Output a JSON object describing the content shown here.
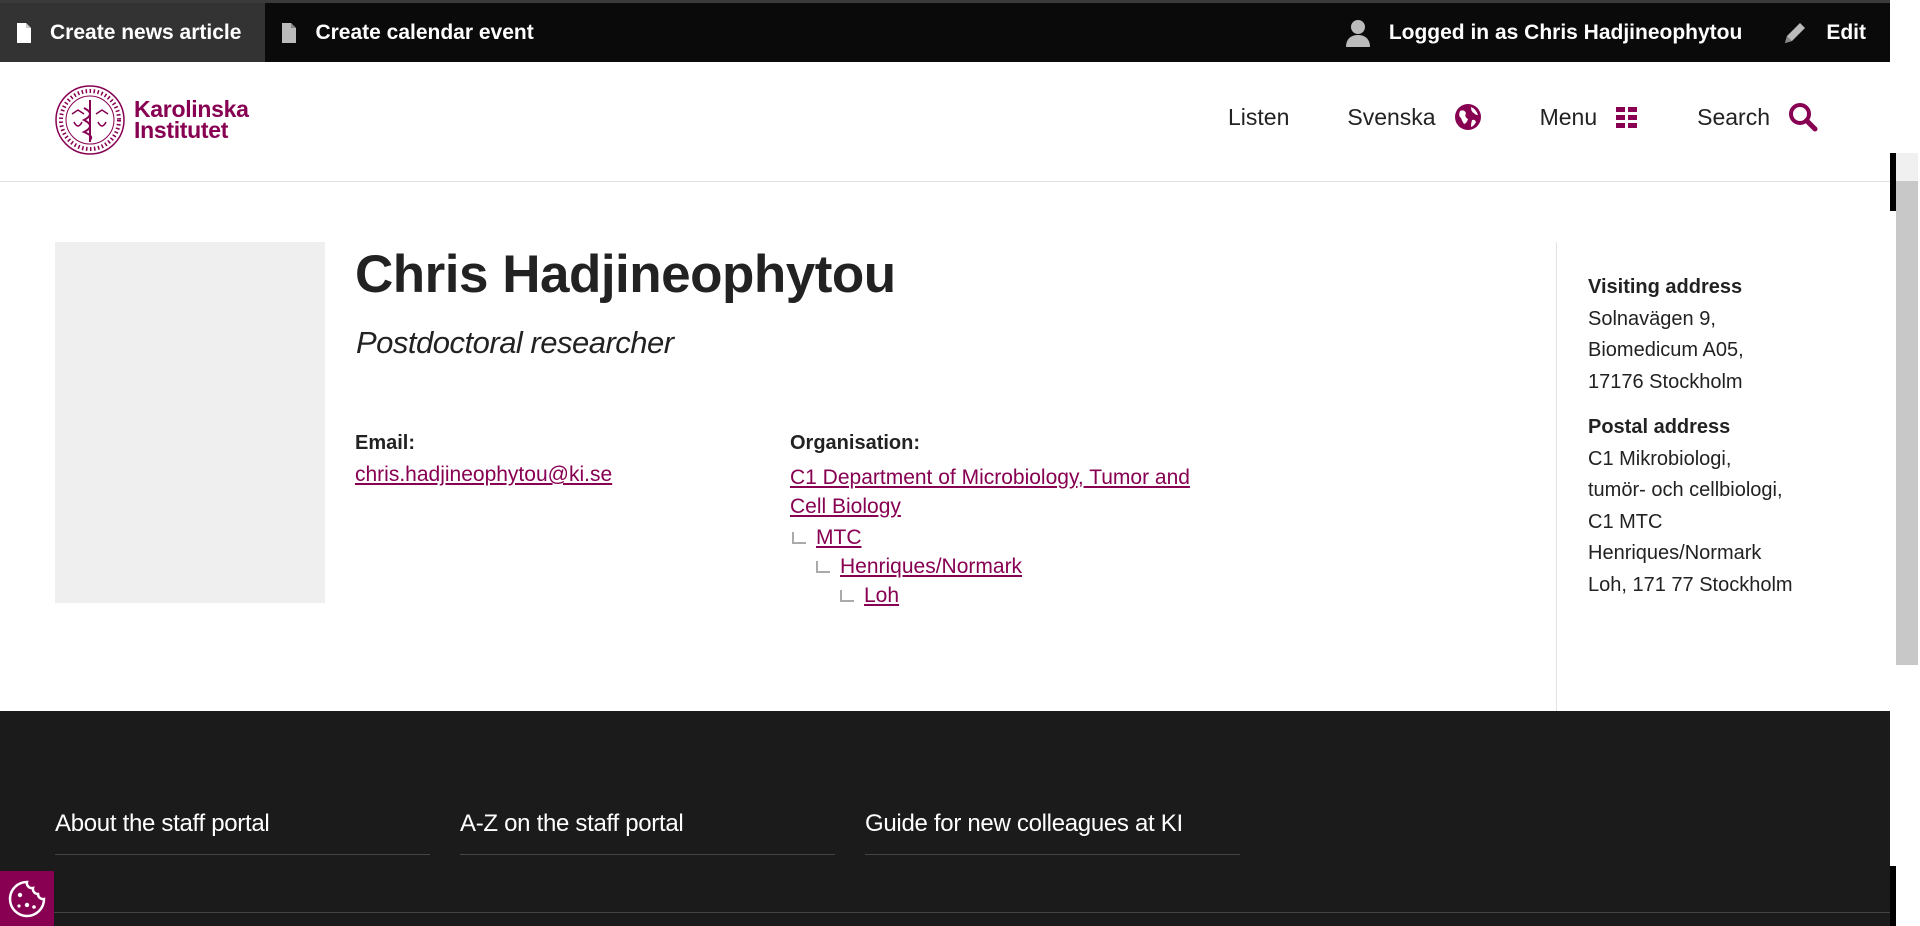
{
  "admin_bar": {
    "create_news": "Create news article",
    "create_event": "Create calendar event",
    "logged_in": "Logged in as Chris Hadjineophytou",
    "edit": "Edit"
  },
  "header": {
    "logo_line1": "Karolinska",
    "logo_line2": "Institutet",
    "nav": {
      "listen": "Listen",
      "language": "Svenska",
      "menu": "Menu",
      "search": "Search"
    }
  },
  "profile": {
    "name": "Chris Hadjineophytou",
    "title": "Postdoctoral researcher",
    "email_label": "Email:",
    "email": "chris.hadjineophytou@ki.se",
    "org_label": "Organisation:",
    "org_root": "C1 Department of Microbiology, Tumor and Cell Biology",
    "org_tree": [
      "MTC",
      "Henriques/Normark",
      "Loh"
    ]
  },
  "sidebar": {
    "visiting_label": "Visiting address",
    "visiting_lines": [
      "Solnavägen 9,",
      "Biomedicum A05,",
      "17176 Stockholm"
    ],
    "postal_label": "Postal address",
    "postal_lines": [
      "C1 Mikrobiologi,",
      "tumör- och cellbiologi,",
      "C1 MTC",
      "Henriques/Normark",
      "Loh, 171 77 Stockholm"
    ]
  },
  "footer": {
    "links": [
      "About the staff portal",
      "A-Z on the staff portal",
      "Guide for new colleagues at KI"
    ]
  },
  "icons": {
    "document": "document-icon",
    "user": "user-icon",
    "pencil": "pencil-icon",
    "globe": "globe-icon",
    "grid": "grid-icon",
    "search": "search-icon",
    "cookie": "cookie-icon"
  },
  "colors": {
    "brand": "#870052",
    "admin_bar": "#0a0a0a",
    "footer": "#1c1b1b"
  }
}
